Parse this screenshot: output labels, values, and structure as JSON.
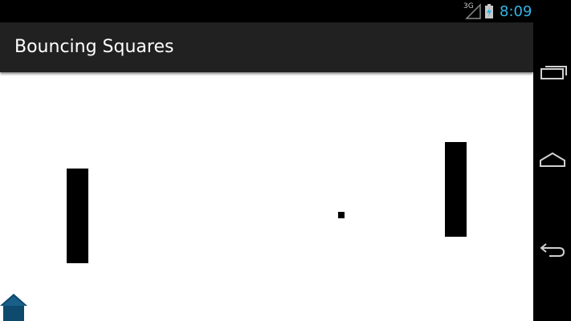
{
  "status_bar": {
    "network_type": "3G",
    "time": "8:09",
    "icons": [
      "signal-icon",
      "battery-charging-icon"
    ]
  },
  "action_bar": {
    "title": "Bouncing Squares"
  },
  "canvas": {
    "elements": [
      "left-paddle",
      "right-paddle",
      "ball"
    ],
    "overlay_icon": "home-icon"
  },
  "nav_bar": {
    "buttons": [
      "recents-icon",
      "home-icon",
      "back-icon"
    ]
  },
  "colors": {
    "action_bar_bg": "#212121",
    "canvas_bg": "#ffffff",
    "clock": "#33b5e5",
    "home_overlay": "#0e4a6e"
  }
}
